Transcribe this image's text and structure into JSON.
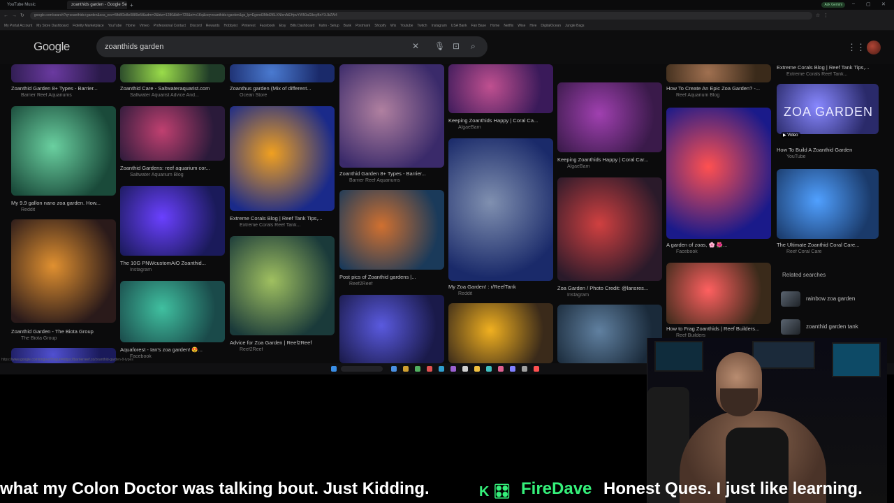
{
  "browser": {
    "tabs": [
      {
        "label": "YouTube Music"
      },
      {
        "label": "zoanthids garden - Google Se..."
      }
    ],
    "new_tab": "+",
    "profile_badge": "Ask Gemini",
    "controls": {
      "minimize": "–",
      "maximize": "▢",
      "close": "✕"
    },
    "url": "google.com/search?q=zoanthids+garden&sca_esv=5fb8f2e8e0889e5f&udm=2&biw=1280&bih=720&ei=x1Kq&oq=zoanthids+garden&gs_lp=Egxnd3Mtd2l6LXNlcnAiEHpvYW50aGlkcyBnYXJkZW4",
    "bookmarks": [
      "My Portal Account",
      "My Store Dashboard",
      "Fidelity Marketplace",
      "YouTube",
      "Home",
      "Vimeo",
      "Professional Contact",
      "Discord",
      "Rewards",
      "Hobbyist",
      "Pinterest",
      "Facebook",
      "Etsy",
      "Bills Dashboard",
      "Kahn · Setup",
      "Bank",
      "Postmark",
      "Shopify",
      "Wix",
      "Youtube",
      "Twitch",
      "Instagram",
      "USA Bank",
      "Fan Base",
      "Home",
      "Netflix",
      "Wise",
      "Hive",
      "DigitalOcean",
      "Jungle Bags"
    ]
  },
  "google": {
    "logo": "Google",
    "query": "zoanthids garden"
  },
  "results": {
    "cards": [
      {
        "caption": "Zoanthid Garden 8+ Types - Barrier...",
        "source": "Barrier Reef Aquariums"
      },
      {
        "caption": "Zoanthid Care - Saltwateraquarist.com",
        "source": "Saltwater Aquarist Advice And..."
      },
      {
        "caption": "Zoanthus garden (Mix of different...",
        "source": "Ocean Store"
      },
      {
        "caption": "Keeping Zoanthids Happy | Coral Ca...",
        "source": "AlgaeBarn"
      },
      {
        "caption": "Keeping Zoanthids Happy | Coral Car...",
        "source": "AlgaeBarn"
      },
      {
        "caption": "How To Create An Epic Zoa Garden? -...",
        "source": "Reef Aquarium Blog"
      },
      {
        "caption": "Extreme Corals Blog | Reef Tank Tips,...",
        "source": "Extreme Corals Reef Tank..."
      },
      {
        "caption": "My 9.9 gallon nano zoa garden. How...",
        "source": "Reddit"
      },
      {
        "caption": "Zoanthid Gardens: reef aquarium cor...",
        "source": "Saltwater Aquarium Blog"
      },
      {
        "caption": "Extreme Corals Blog | Reef Tank Tips,...",
        "source": "Extreme Corals Reef Tank..."
      },
      {
        "caption": "Zoanthid Garden 8+ Types - Barrier...",
        "source": "Barrier Reef Aquariums"
      },
      {
        "caption": "How To Build A Zoanthid Garden",
        "source": "YouTube"
      },
      {
        "caption": "The 10G PNWcustomAiO Zoanthid...",
        "source": "Instagram"
      },
      {
        "caption": "Post pics of Zoanthid gardens |...",
        "source": "Reef2Reef"
      },
      {
        "caption": "My Zoa Garden! : r/ReefTank",
        "source": "Reddit"
      },
      {
        "caption": "Zoa Garden / Photo Credit: @lansres...",
        "source": "Instagram"
      },
      {
        "caption": "A garden of zoas, 🌸 🌺...",
        "source": "Facebook"
      },
      {
        "caption": "The Ultimate Zoanthid Coral Care...",
        "source": "Reef Coral Care"
      },
      {
        "caption": "Zoanthid Garden - The Biota Group",
        "source": "The Biota Group"
      },
      {
        "caption": "Aquaforest - Ian's zoa garden! 😍...",
        "source": "Facebook"
      },
      {
        "caption": "Advice for Zoa Garden | Reef2Reef",
        "source": "Reef2Reef"
      },
      {
        "caption": "How to Frag Zoanthids | Reef Builders...",
        "source": "Reef Builders"
      }
    ],
    "overlay_text": "ZOA GARDEN",
    "video_badge": "▶ Video",
    "related_title": "Related searches",
    "related": [
      {
        "label": "rainbow zoa garden"
      },
      {
        "label": "zoanthid garden tank"
      }
    ],
    "status_url": "https://www.google.com/imgres?imgurl=https://barrierreef.co/zoanthid-garden-8-types"
  },
  "stream": {
    "ticker_left": "what my Colon Doctor was talking bout. Just Kidding.",
    "ticker_logo": "K 🎛",
    "ticker_name": "FireDave",
    "ticker_msg": "Honest Ques. I just like learning."
  },
  "colors": {
    "ticker_accent": "#35f07a",
    "background": "#000000"
  }
}
